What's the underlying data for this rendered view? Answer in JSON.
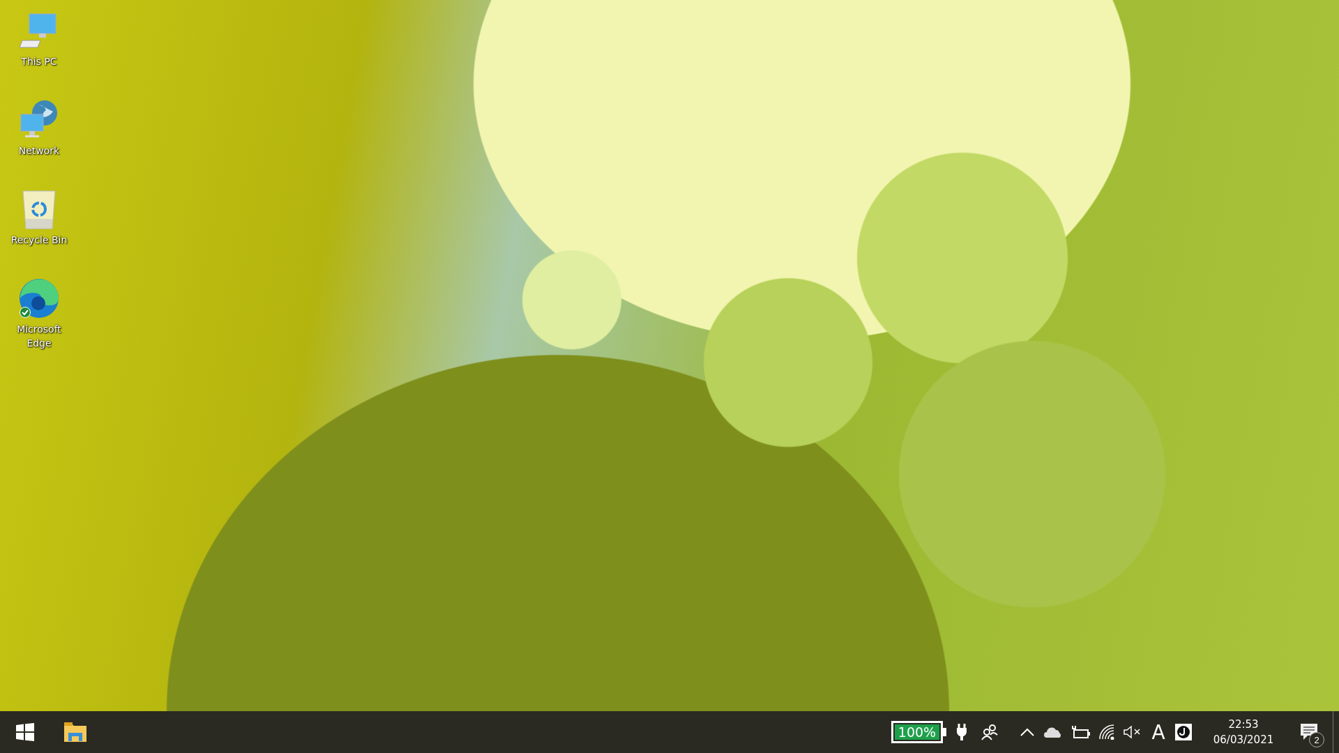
{
  "desktop_icons": [
    {
      "kind": "pc",
      "label": "This PC"
    },
    {
      "kind": "network",
      "label": "Network"
    },
    {
      "kind": "bin",
      "label": "Recycle Bin"
    },
    {
      "kind": "edge",
      "label": "Microsoft Edge",
      "synced": true
    }
  ],
  "taskbar": {
    "pinned": [
      {
        "kind": "start"
      },
      {
        "kind": "explorer"
      }
    ],
    "battery": {
      "reading": "100%",
      "level": 1,
      "plugged": true
    },
    "tray": [
      {
        "kind": "people"
      },
      {
        "kind": "chevron"
      },
      {
        "kind": "cloud"
      },
      {
        "kind": "power"
      },
      {
        "kind": "wifi"
      },
      {
        "kind": "mute"
      },
      {
        "kind": "text",
        "label": "A"
      },
      {
        "kind": "app"
      }
    ],
    "clock": {
      "time": "22:53",
      "date": "06/03/2021"
    },
    "notifications": {
      "count": "2"
    }
  }
}
